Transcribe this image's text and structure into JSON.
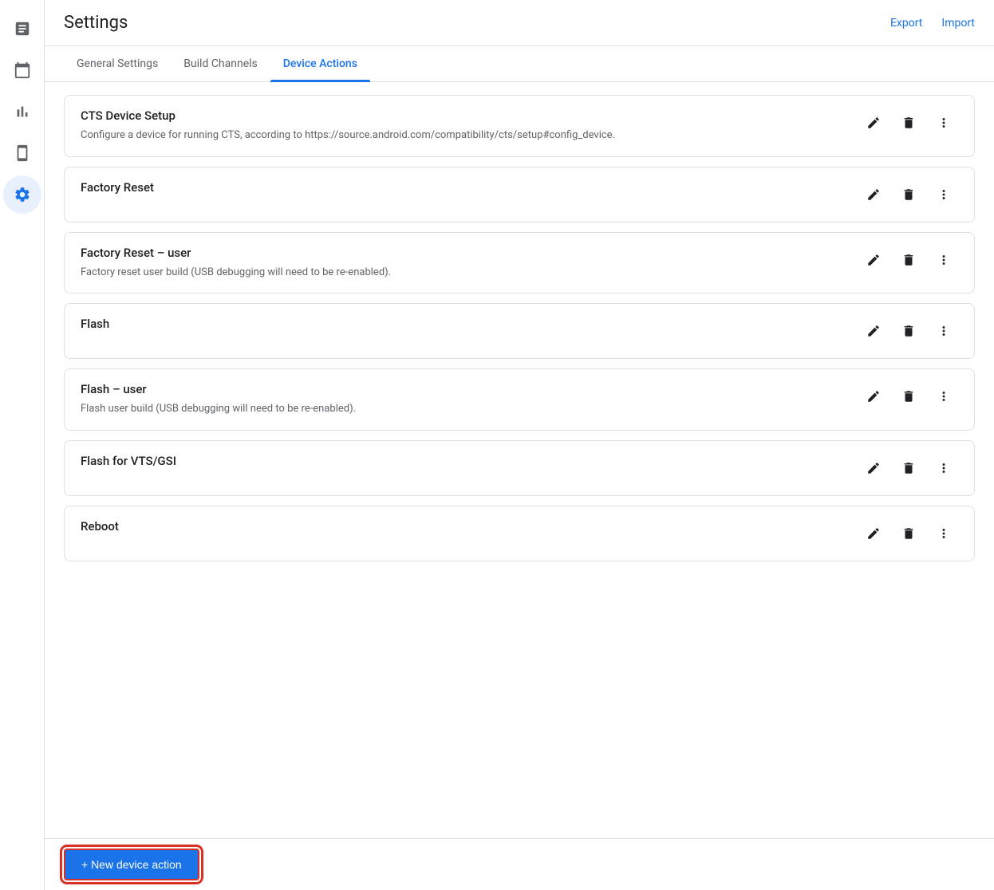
{
  "header": {
    "title": "Settings",
    "export_label": "Export",
    "import_label": "Import"
  },
  "tabs": [
    {
      "id": "general-settings",
      "label": "General Settings",
      "active": false
    },
    {
      "id": "build-channels",
      "label": "Build Channels",
      "active": false
    },
    {
      "id": "device-actions",
      "label": "Device Actions",
      "active": true
    }
  ],
  "sidebar": {
    "items": [
      {
        "id": "reports",
        "icon": "📋",
        "tooltip": "Reports"
      },
      {
        "id": "calendar",
        "icon": "📅",
        "tooltip": "Calendar"
      },
      {
        "id": "analytics",
        "icon": "📊",
        "tooltip": "Analytics"
      },
      {
        "id": "devices",
        "icon": "📱",
        "tooltip": "Devices"
      },
      {
        "id": "settings",
        "icon": "⚙",
        "tooltip": "Settings",
        "active": true
      }
    ]
  },
  "actions": [
    {
      "id": "cts-device-setup",
      "title": "CTS Device Setup",
      "description": "Configure a device for running CTS, according to https://source.android.com/compatibility/cts/setup#config_device."
    },
    {
      "id": "factory-reset",
      "title": "Factory Reset",
      "description": ""
    },
    {
      "id": "factory-reset-user",
      "title": "Factory Reset – user",
      "description": "Factory reset user build (USB debugging will need to be re-enabled)."
    },
    {
      "id": "flash",
      "title": "Flash",
      "description": ""
    },
    {
      "id": "flash-user",
      "title": "Flash – user",
      "description": "Flash user build (USB debugging will need to be re-enabled)."
    },
    {
      "id": "flash-vts-gsi",
      "title": "Flash for VTS/GSI",
      "description": ""
    },
    {
      "id": "reboot",
      "title": "Reboot",
      "description": ""
    }
  ],
  "buttons": {
    "edit_title": "Edit",
    "delete_title": "Delete",
    "more_title": "More options",
    "new_action_label": "+ New device action"
  }
}
